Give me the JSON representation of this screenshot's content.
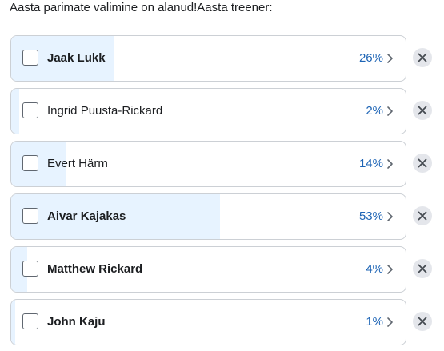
{
  "poll": {
    "question": "Aasta parimate valimine on alanud!Aasta treener:",
    "options": [
      {
        "label": "Jaak Lukk",
        "percent_text": "26%",
        "percent": 26
      },
      {
        "label": "Ingrid Puusta-Rickard",
        "percent_text": "2%",
        "percent": 2
      },
      {
        "label": "Evert Härm",
        "percent_text": "14%",
        "percent": 14
      },
      {
        "label": "Aivar Kajakas",
        "percent_text": "53%",
        "percent": 53
      },
      {
        "label": "Matthew Rickard",
        "percent_text": "4%",
        "percent": 4
      },
      {
        "label": "John Kaju",
        "percent_text": "1%",
        "percent": 1
      }
    ]
  },
  "icons": {
    "checkbox": "checkbox-icon",
    "chevron": "chevron-right-icon",
    "remove": "close-icon"
  },
  "colors": {
    "fill": "#e7f3ff",
    "percent_text": "#1d64b5",
    "remove_bg": "#e4e6eb"
  }
}
